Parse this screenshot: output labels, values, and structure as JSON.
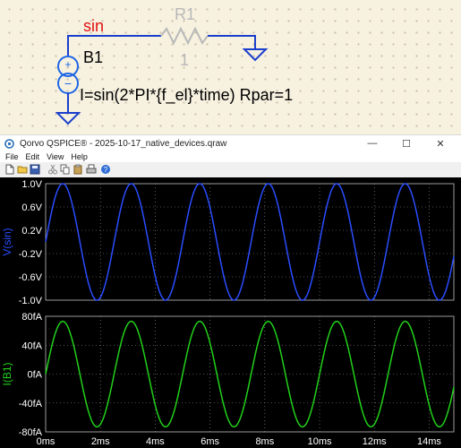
{
  "schematic": {
    "net_label": "sin",
    "resistor_ref": "R1",
    "resistor_value": "1",
    "source_ref": "B1",
    "source_expr": "I=sin(2*PI*{f_el}*time) Rpar=1",
    "colors": {
      "net_label": "#e01010",
      "wire": "#1a3fcc",
      "resistor": "#b8b8b8",
      "source": "#1e66e6",
      "text": "#000000"
    }
  },
  "window": {
    "title": "Qorvo QSPICE® - 2025-10-17_native_devices.qraw",
    "min_glyph": "—",
    "max_glyph": "☐",
    "close_glyph": "✕"
  },
  "menu": [
    "File",
    "Edit",
    "View",
    "Help"
  ],
  "toolbar_icons": [
    "new-icon",
    "open-icon",
    "save-icon",
    "cut-icon",
    "copy-icon",
    "paste-icon",
    "print-icon",
    "help-icon"
  ],
  "plot": {
    "colors": {
      "background": "#000000",
      "grid": "#9a9a9a",
      "axis_text": "#ffffff",
      "trace_top": "#2a4dff",
      "trace_bottom": "#22d11a"
    },
    "x_ticks": [
      "0ms",
      "2ms",
      "4ms",
      "6ms",
      "8ms",
      "10ms",
      "12ms",
      "14ms"
    ],
    "top_axis_label": "V(sin)",
    "top_ticks": [
      "1.0V",
      "0.6V",
      "0.2V",
      "-0.2V",
      "-0.6V",
      "-1.0V"
    ],
    "bottom_axis_label": "I(B1)",
    "bottom_ticks": [
      "80fA",
      "40fA",
      "0fA",
      "-40fA",
      "-80fA"
    ]
  },
  "chart_data": [
    {
      "type": "line",
      "title": "",
      "xlabel": "",
      "ylabel": "V(sin)",
      "xlim": [
        0,
        14.9
      ],
      "ylim": [
        -1.0,
        1.0
      ],
      "series": [
        {
          "name": "V(sin)",
          "amplitude": 1.0,
          "period_ms": 2.5,
          "phase": "sine starting at 0"
        }
      ]
    },
    {
      "type": "line",
      "title": "",
      "xlabel": "",
      "ylabel": "I(B1)",
      "xlim": [
        0,
        14.9
      ],
      "ylim": [
        -80,
        80
      ],
      "y_unit": "fA",
      "series": [
        {
          "name": "I(B1)",
          "amplitude": 73,
          "period_ms": 2.5,
          "phase": "sine starting at 0"
        }
      ]
    }
  ]
}
